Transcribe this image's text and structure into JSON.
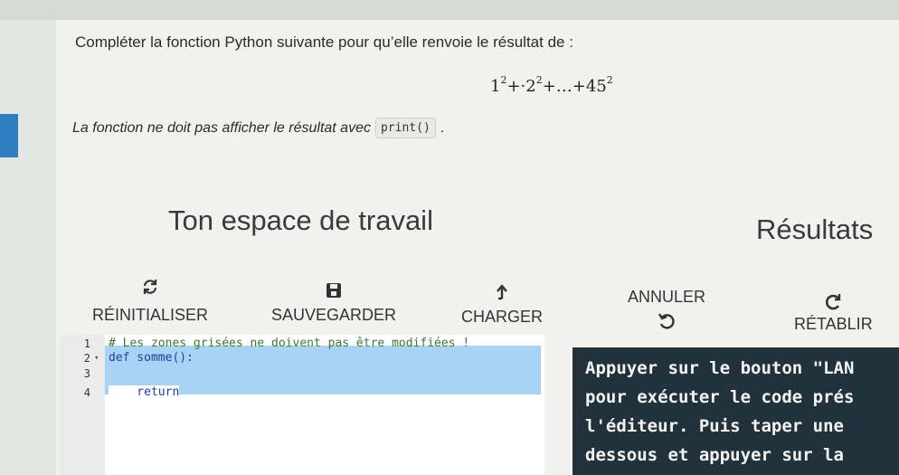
{
  "question": {
    "intro": "Compléter la fonction Python suivante pour qu’elle renvoie le résultat de :",
    "formula": {
      "t1": "1",
      "e1": "2",
      "op1": "+·2",
      "e2": "2",
      "op2": "+…+45",
      "e3": "2"
    },
    "note": "La fonction ne doit pas afficher le résultat avec",
    "note_code": "print()",
    "note_end": "."
  },
  "workspace": {
    "title": "Ton espace de travail",
    "toolbar": {
      "reset": "RÉINITIALISER",
      "save": "SAUVEGARDER",
      "load": "CHARGER",
      "undo": "ANNULER",
      "redo": "RÉTABLIR"
    },
    "editor": {
      "lines": [
        {
          "num": "1",
          "text": "# Les zones grisées ne doivent pas être modifiées !"
        },
        {
          "num": "2",
          "text": "def somme():"
        },
        {
          "num": "3",
          "text": ""
        },
        {
          "num": "4",
          "text": "    return"
        }
      ]
    }
  },
  "results": {
    "title": "Résultats",
    "console_lines": [
      "Appuyer sur le bouton \"LAN",
      "pour exécuter le code prés",
      "l'éditeur. Puis taper une ",
      "dessous et appuyer sur la "
    ]
  },
  "icons": {
    "reset": "refresh-icon",
    "save": "floppy-icon",
    "load": "upload-arrow-icon",
    "undo": "undo-icon",
    "redo": "redo-icon"
  },
  "colors": {
    "accent": "#2d7fbf",
    "console_bg": "#22323c",
    "readonly_zone": "#a9d3f5"
  }
}
